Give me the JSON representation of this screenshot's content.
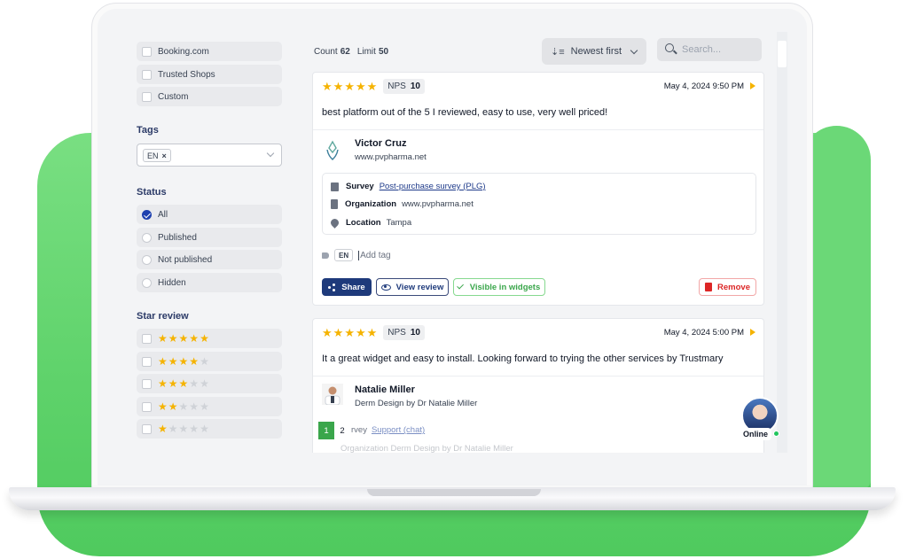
{
  "sidebar": {
    "sources": [
      {
        "label": "Booking.com",
        "checked": false
      },
      {
        "label": "Trusted Shops",
        "checked": false
      },
      {
        "label": "Custom",
        "checked": false
      }
    ],
    "tags_title": "Tags",
    "tags_selected": "EN",
    "tags_remove_symbol": "×",
    "status_title": "Status",
    "status_options": [
      {
        "label": "All",
        "selected": true
      },
      {
        "label": "Published",
        "selected": false
      },
      {
        "label": "Not published",
        "selected": false
      },
      {
        "label": "Hidden",
        "selected": false
      }
    ],
    "star_title": "Star review",
    "star_filters": [
      5,
      4,
      3,
      2,
      1
    ]
  },
  "toolbar": {
    "count_label": "Count",
    "count_value": "62",
    "limit_label": "Limit",
    "limit_value": "50",
    "sort_label": "Newest first",
    "search_placeholder": "Search..."
  },
  "reviews": [
    {
      "stars": 5,
      "nps_label": "NPS",
      "nps_value": "10",
      "date": "May 4, 2024 9:50 PM",
      "text": "best platform out of the 5 I reviewed, easy to use, very well priced!",
      "name": "Victor Cruz",
      "org": "www.pvpharma.net",
      "survey_label": "Survey",
      "survey_value": "Post-purchase survey (PLG)",
      "organization_label": "Organization",
      "organization_value": "www.pvpharma.net",
      "location_label": "Location",
      "location_value": "Tampa",
      "tag": "EN",
      "add_tag": "Add tag",
      "share_label": "Share",
      "view_label": "View review",
      "visible_label": "Visible in widgets",
      "remove_label": "Remove"
    },
    {
      "stars": 5,
      "nps_label": "NPS",
      "nps_value": "10",
      "date": "May 4, 2024 5:00 PM",
      "text": "It a great widget and easy to install. Looking forward to trying the other services by Trustmary",
      "name": "Natalie Miller",
      "org": "Derm Design by Dr Natalie Miller",
      "survey_label_partial": "rvey",
      "survey_value": "Support (chat)",
      "organization_partial": "Organization   Derm Design by Dr Natalie Miller"
    }
  ],
  "pagination": {
    "pages": [
      "1",
      "2"
    ],
    "current": "1"
  },
  "chat": {
    "status": "Online"
  },
  "colors": {
    "accent_navy": "#1e3a7b",
    "star": "#f5b300",
    "success": "#3aa64b",
    "danger": "#dc2626",
    "brand_green": "#5ed26a"
  }
}
